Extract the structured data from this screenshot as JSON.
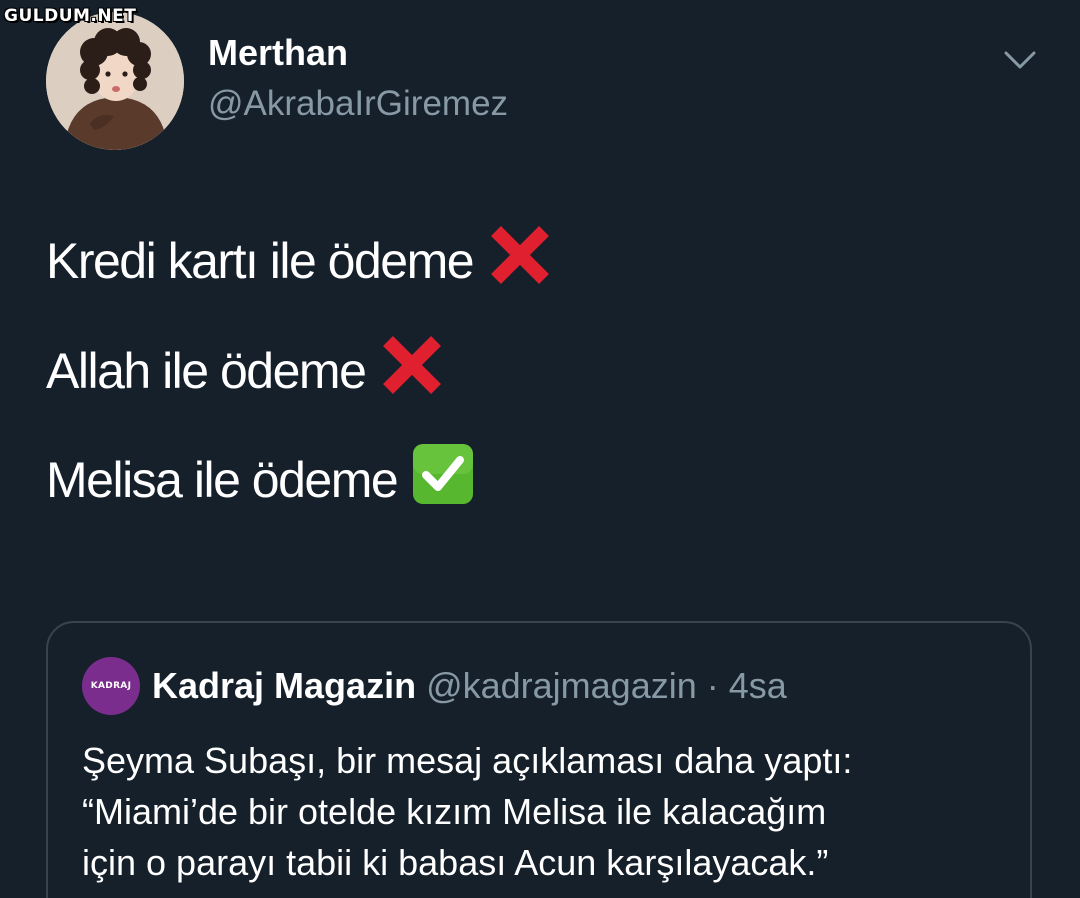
{
  "watermark": "GULDUM.NET",
  "tweet": {
    "display_name": "Merthan",
    "handle": "@AkrabaIrGiremez",
    "more_icon": "chevron-down-icon",
    "lines": [
      {
        "text": "Kredi kartı ile ödeme",
        "icon": "cross-mark-icon"
      },
      {
        "text": "Allah ile ödeme",
        "icon": "cross-mark-icon"
      },
      {
        "text": "Melisa ile ödeme",
        "icon": "check-mark-button-icon"
      }
    ]
  },
  "quoted_tweet": {
    "avatar_text": "KADRAJ",
    "display_name": "Kadraj Magazin",
    "handle": "@kadrajmagazin",
    "separator": "·",
    "time": "4sa",
    "body_lines": [
      "Şeyma Subaşı, bir mesaj açıklaması daha yaptı:",
      "“Miami’de bir otelde kızım Melisa ile kalacağım",
      "için o parayı tabii ki babası Acun karşılayacak.”"
    ]
  },
  "colors": {
    "background": "#15202b",
    "text_primary": "#ffffff",
    "text_secondary": "#8899a6",
    "border": "#38444d",
    "cross_red": "#e0202e",
    "check_green": "#57b82f",
    "kadraj_purple": "#7b2d8e"
  }
}
